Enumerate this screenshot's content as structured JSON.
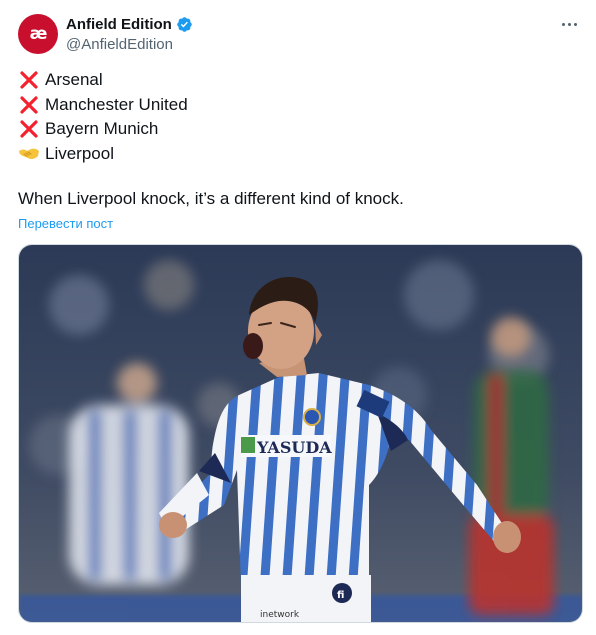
{
  "author": {
    "display_name": "Anfield Edition",
    "handle": "@AnfieldEdition",
    "avatar_text": "æ",
    "verified_icon": "verified-badge-icon",
    "brand_color": "#c8102e"
  },
  "menu": {
    "icon": "more-options-icon"
  },
  "tweet": {
    "lines": [
      {
        "icon": "cross-mark-icon",
        "text": "Arsenal"
      },
      {
        "icon": "cross-mark-icon",
        "text": "Manchester United"
      },
      {
        "icon": "cross-mark-icon",
        "text": "Bayern Munich"
      },
      {
        "icon": "handshake-icon",
        "text": "Liverpool"
      }
    ],
    "caption": "When Liverpool knock, it’s a different kind of knock.",
    "translate_link": "Перевести пост"
  },
  "media": {
    "sponsor_text": "YASUDA",
    "colors": {
      "accent": "#1d9bf0",
      "cross": "#f4212e",
      "shirt_blue": "#3d6fc4"
    }
  }
}
